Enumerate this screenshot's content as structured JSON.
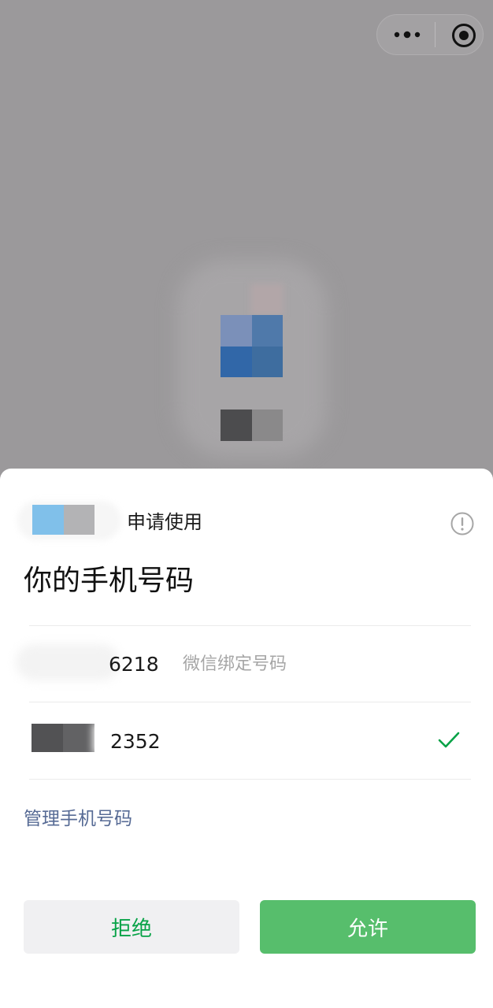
{
  "colors": {
    "backdrop": "#9b999b",
    "sheet": "#ffffff",
    "accent_green": "#57be6c",
    "deny_text": "#07a247",
    "link_blue": "#576b95",
    "muted_text": "#a6a6a6"
  },
  "capsule": {
    "more_icon": "more-dots-icon",
    "close_icon": "close-miniprogram-icon"
  },
  "background_page": {
    "app_icon_mosaic": [
      "#7b90b9",
      "#4f79aa",
      "#3167a8",
      "#3e6d9f"
    ],
    "app_name_mosaic": [
      "#4c4c4e",
      "#8a898a"
    ]
  },
  "sheet": {
    "app_avatar_mosaic": [
      "#80c0ea",
      "#b3b3b5"
    ],
    "request_label": "申请使用",
    "info_icon": "info-icon",
    "title": "你的手机号码",
    "phones": [
      {
        "number_suffix": "6218",
        "tag": "微信绑定号码",
        "selected": false
      },
      {
        "number_suffix": "2352",
        "mask_mosaic": [
          "#525254",
          "#626264"
        ],
        "selected": true,
        "check_icon": "checkmark-icon"
      }
    ],
    "manage_link": "管理手机号码",
    "deny_button": "拒绝",
    "allow_button": "允许"
  }
}
